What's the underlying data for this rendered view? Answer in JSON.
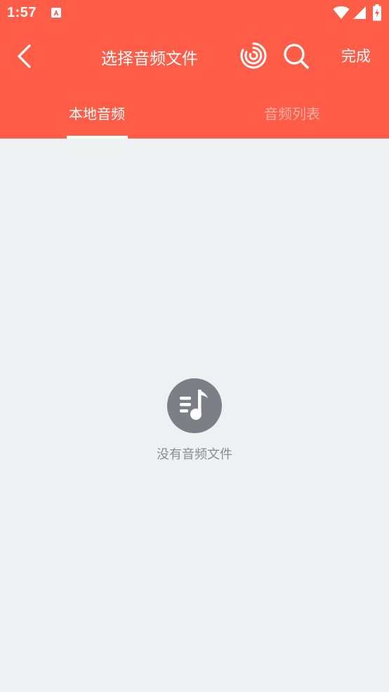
{
  "status_bar": {
    "time": "1:57",
    "icons": [
      "notification-a-icon",
      "wifi-icon",
      "signal-icon",
      "battery-charging-icon"
    ]
  },
  "app_bar": {
    "title": "选择音频文件",
    "done_label": "完成",
    "icons": [
      "back-chevron-icon",
      "radar-icon",
      "search-icon"
    ]
  },
  "tabs": [
    {
      "label": "本地音频",
      "active": true
    },
    {
      "label": "音频列表",
      "active": false
    }
  ],
  "empty_state": {
    "icon": "music-playlist-icon",
    "message": "没有音频文件"
  },
  "colors": {
    "header": "#ff5d48",
    "background": "#eef1f2",
    "inactive_tab": "#ffb0a5",
    "empty_icon": "#7d7f86",
    "empty_text": "#8a8c90"
  }
}
